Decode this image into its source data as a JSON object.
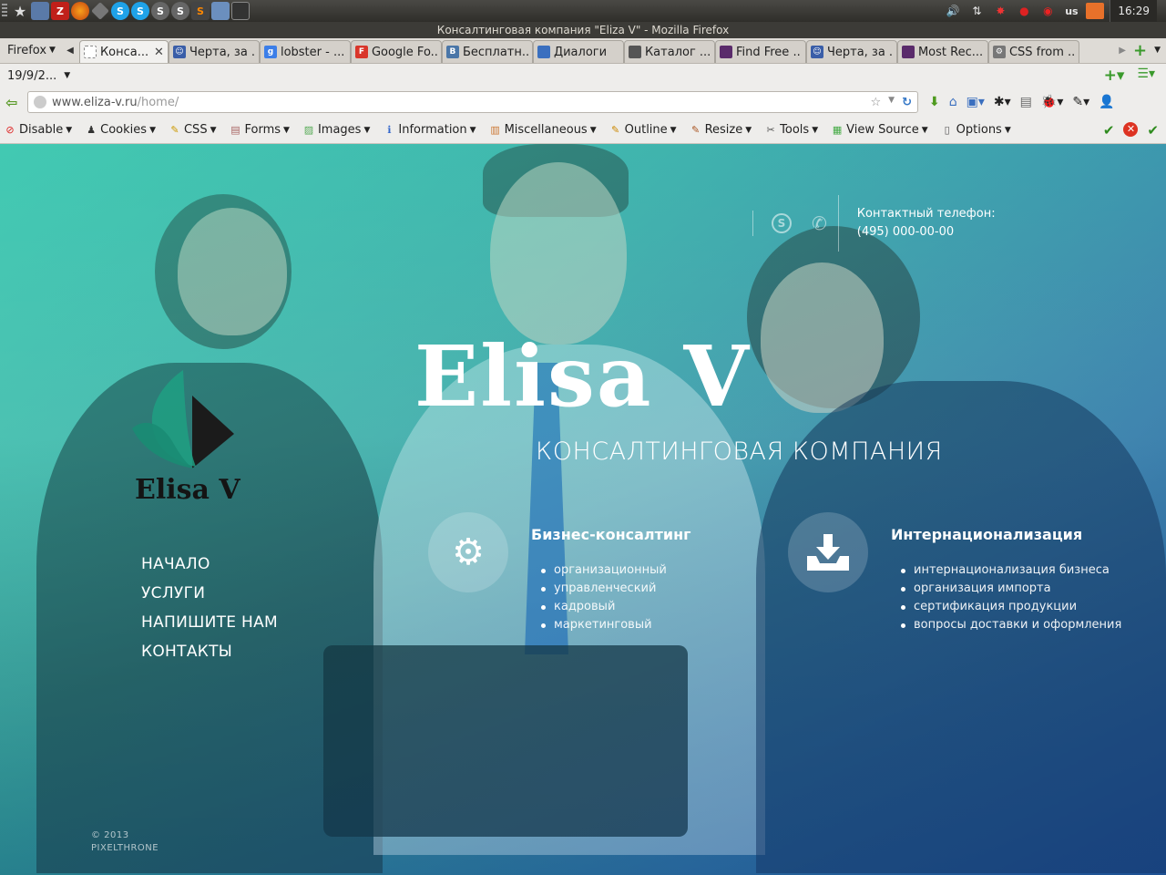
{
  "system_panel": {
    "keyboard_layout": "us",
    "clock": "16:29"
  },
  "window": {
    "title": "Консалтинговая компания \"Eliza V\" - Mozilla Firefox"
  },
  "firefox_menu": "Firefox",
  "tabs": [
    {
      "label": "Конса...",
      "icon": "blank-page-icon",
      "active": true
    },
    {
      "label": "Черта, за ...",
      "icon": "user-icon"
    },
    {
      "label": "lobster - ...",
      "icon": "google-icon"
    },
    {
      "label": "Google Fo...",
      "icon": "google-fonts-icon"
    },
    {
      "label": "Бесплатн...",
      "icon": "vk-icon"
    },
    {
      "label": "Диалоги",
      "icon": "dialog-icon"
    },
    {
      "label": "Каталог ...",
      "icon": "catalog-icon"
    },
    {
      "label": "Find Free ...",
      "icon": "fish-icon"
    },
    {
      "label": "Черта, за ...",
      "icon": "user-icon"
    },
    {
      "label": "Most Rec...",
      "icon": "fish-icon"
    },
    {
      "label": "CSS from ...",
      "icon": "gear-icon"
    }
  ],
  "bookmark_row": {
    "date_label": "19/9/2..."
  },
  "navbar": {
    "url_host": "www.eliza-v.ru",
    "url_path": "/home/"
  },
  "dev_toolbar": {
    "items": [
      "Disable",
      "Cookies",
      "CSS",
      "Forms",
      "Images",
      "Information",
      "Miscellaneous",
      "Outline",
      "Resize",
      "Tools",
      "View Source",
      "Options"
    ]
  },
  "site": {
    "contact": {
      "label": "Контактный телефон:",
      "phone": "(495) 000-00-00"
    },
    "hero_title": "Elisa V",
    "hero_subtitle": "КОНСАЛТИНГОВАЯ КОМПАНИЯ",
    "logo_text": "Elisa V",
    "nav": [
      "НАЧАЛО",
      "УСЛУГИ",
      "НАПИШИТЕ НАМ",
      "КОНТАКТЫ"
    ],
    "services": [
      {
        "title": "Бизнес-консалтинг",
        "icon": "gear-icon",
        "items": [
          "организационный",
          "управленческий",
          "кадровый",
          "маркетинговый"
        ]
      },
      {
        "title": "Интернационализация",
        "icon": "download-tray-icon",
        "items": [
          "интернационализация бизнеса",
          "организация импорта",
          "сертификация продукции",
          "вопросы доставки и оформления"
        ]
      }
    ],
    "copyright_year": "© 2013",
    "copyright_owner": "PIXELTHRONE"
  }
}
